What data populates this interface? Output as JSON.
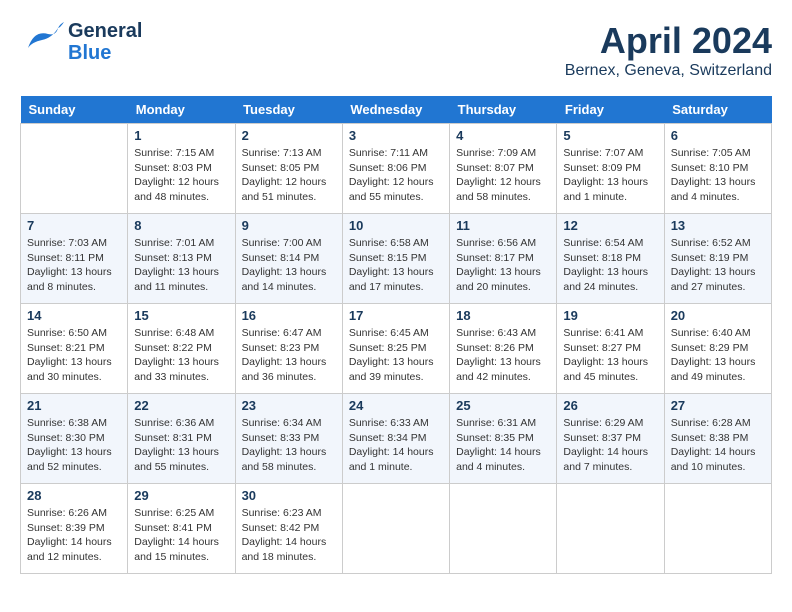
{
  "header": {
    "logo_general": "General",
    "logo_blue": "Blue",
    "month": "April 2024",
    "location": "Bernex, Geneva, Switzerland"
  },
  "weekdays": [
    "Sunday",
    "Monday",
    "Tuesday",
    "Wednesday",
    "Thursday",
    "Friday",
    "Saturday"
  ],
  "weeks": [
    [
      {
        "day": "",
        "sunrise": "",
        "sunset": "",
        "daylight": ""
      },
      {
        "day": "1",
        "sunrise": "Sunrise: 7:15 AM",
        "sunset": "Sunset: 8:03 PM",
        "daylight": "Daylight: 12 hours and 48 minutes."
      },
      {
        "day": "2",
        "sunrise": "Sunrise: 7:13 AM",
        "sunset": "Sunset: 8:05 PM",
        "daylight": "Daylight: 12 hours and 51 minutes."
      },
      {
        "day": "3",
        "sunrise": "Sunrise: 7:11 AM",
        "sunset": "Sunset: 8:06 PM",
        "daylight": "Daylight: 12 hours and 55 minutes."
      },
      {
        "day": "4",
        "sunrise": "Sunrise: 7:09 AM",
        "sunset": "Sunset: 8:07 PM",
        "daylight": "Daylight: 12 hours and 58 minutes."
      },
      {
        "day": "5",
        "sunrise": "Sunrise: 7:07 AM",
        "sunset": "Sunset: 8:09 PM",
        "daylight": "Daylight: 13 hours and 1 minute."
      },
      {
        "day": "6",
        "sunrise": "Sunrise: 7:05 AM",
        "sunset": "Sunset: 8:10 PM",
        "daylight": "Daylight: 13 hours and 4 minutes."
      }
    ],
    [
      {
        "day": "7",
        "sunrise": "Sunrise: 7:03 AM",
        "sunset": "Sunset: 8:11 PM",
        "daylight": "Daylight: 13 hours and 8 minutes."
      },
      {
        "day": "8",
        "sunrise": "Sunrise: 7:01 AM",
        "sunset": "Sunset: 8:13 PM",
        "daylight": "Daylight: 13 hours and 11 minutes."
      },
      {
        "day": "9",
        "sunrise": "Sunrise: 7:00 AM",
        "sunset": "Sunset: 8:14 PM",
        "daylight": "Daylight: 13 hours and 14 minutes."
      },
      {
        "day": "10",
        "sunrise": "Sunrise: 6:58 AM",
        "sunset": "Sunset: 8:15 PM",
        "daylight": "Daylight: 13 hours and 17 minutes."
      },
      {
        "day": "11",
        "sunrise": "Sunrise: 6:56 AM",
        "sunset": "Sunset: 8:17 PM",
        "daylight": "Daylight: 13 hours and 20 minutes."
      },
      {
        "day": "12",
        "sunrise": "Sunrise: 6:54 AM",
        "sunset": "Sunset: 8:18 PM",
        "daylight": "Daylight: 13 hours and 24 minutes."
      },
      {
        "day": "13",
        "sunrise": "Sunrise: 6:52 AM",
        "sunset": "Sunset: 8:19 PM",
        "daylight": "Daylight: 13 hours and 27 minutes."
      }
    ],
    [
      {
        "day": "14",
        "sunrise": "Sunrise: 6:50 AM",
        "sunset": "Sunset: 8:21 PM",
        "daylight": "Daylight: 13 hours and 30 minutes."
      },
      {
        "day": "15",
        "sunrise": "Sunrise: 6:48 AM",
        "sunset": "Sunset: 8:22 PM",
        "daylight": "Daylight: 13 hours and 33 minutes."
      },
      {
        "day": "16",
        "sunrise": "Sunrise: 6:47 AM",
        "sunset": "Sunset: 8:23 PM",
        "daylight": "Daylight: 13 hours and 36 minutes."
      },
      {
        "day": "17",
        "sunrise": "Sunrise: 6:45 AM",
        "sunset": "Sunset: 8:25 PM",
        "daylight": "Daylight: 13 hours and 39 minutes."
      },
      {
        "day": "18",
        "sunrise": "Sunrise: 6:43 AM",
        "sunset": "Sunset: 8:26 PM",
        "daylight": "Daylight: 13 hours and 42 minutes."
      },
      {
        "day": "19",
        "sunrise": "Sunrise: 6:41 AM",
        "sunset": "Sunset: 8:27 PM",
        "daylight": "Daylight: 13 hours and 45 minutes."
      },
      {
        "day": "20",
        "sunrise": "Sunrise: 6:40 AM",
        "sunset": "Sunset: 8:29 PM",
        "daylight": "Daylight: 13 hours and 49 minutes."
      }
    ],
    [
      {
        "day": "21",
        "sunrise": "Sunrise: 6:38 AM",
        "sunset": "Sunset: 8:30 PM",
        "daylight": "Daylight: 13 hours and 52 minutes."
      },
      {
        "day": "22",
        "sunrise": "Sunrise: 6:36 AM",
        "sunset": "Sunset: 8:31 PM",
        "daylight": "Daylight: 13 hours and 55 minutes."
      },
      {
        "day": "23",
        "sunrise": "Sunrise: 6:34 AM",
        "sunset": "Sunset: 8:33 PM",
        "daylight": "Daylight: 13 hours and 58 minutes."
      },
      {
        "day": "24",
        "sunrise": "Sunrise: 6:33 AM",
        "sunset": "Sunset: 8:34 PM",
        "daylight": "Daylight: 14 hours and 1 minute."
      },
      {
        "day": "25",
        "sunrise": "Sunrise: 6:31 AM",
        "sunset": "Sunset: 8:35 PM",
        "daylight": "Daylight: 14 hours and 4 minutes."
      },
      {
        "day": "26",
        "sunrise": "Sunrise: 6:29 AM",
        "sunset": "Sunset: 8:37 PM",
        "daylight": "Daylight: 14 hours and 7 minutes."
      },
      {
        "day": "27",
        "sunrise": "Sunrise: 6:28 AM",
        "sunset": "Sunset: 8:38 PM",
        "daylight": "Daylight: 14 hours and 10 minutes."
      }
    ],
    [
      {
        "day": "28",
        "sunrise": "Sunrise: 6:26 AM",
        "sunset": "Sunset: 8:39 PM",
        "daylight": "Daylight: 14 hours and 12 minutes."
      },
      {
        "day": "29",
        "sunrise": "Sunrise: 6:25 AM",
        "sunset": "Sunset: 8:41 PM",
        "daylight": "Daylight: 14 hours and 15 minutes."
      },
      {
        "day": "30",
        "sunrise": "Sunrise: 6:23 AM",
        "sunset": "Sunset: 8:42 PM",
        "daylight": "Daylight: 14 hours and 18 minutes."
      },
      {
        "day": "",
        "sunrise": "",
        "sunset": "",
        "daylight": ""
      },
      {
        "day": "",
        "sunrise": "",
        "sunset": "",
        "daylight": ""
      },
      {
        "day": "",
        "sunrise": "",
        "sunset": "",
        "daylight": ""
      },
      {
        "day": "",
        "sunrise": "",
        "sunset": "",
        "daylight": ""
      }
    ]
  ]
}
